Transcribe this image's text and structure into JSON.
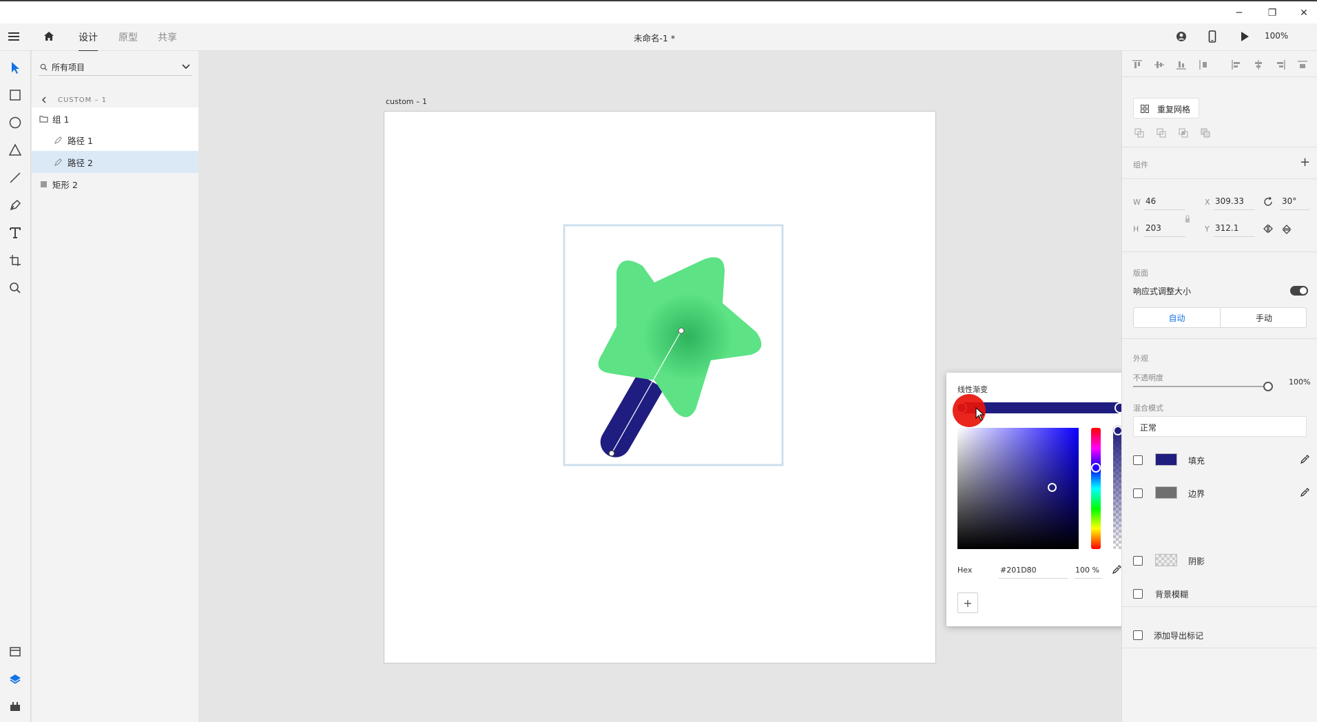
{
  "window": {
    "minimize": "─",
    "restore": "❐",
    "close": "✕"
  },
  "appbar": {
    "tabs": [
      "设计",
      "原型",
      "共享"
    ],
    "doc_title": "未命名-1 *",
    "zoom": "100%"
  },
  "layers": {
    "search_placeholder": "所有项目",
    "breadcrumb": "CUSTOM – 1",
    "items": [
      {
        "label": "组 1"
      },
      {
        "label": "路径 1"
      },
      {
        "label": "路径 2"
      },
      {
        "label": "矩形 2"
      }
    ]
  },
  "canvas": {
    "artboard_label": "custom – 1"
  },
  "props": {
    "repeat_grid": "重复网格",
    "components_label": "组件",
    "w_label": "W",
    "w": "46",
    "h_label": "H",
    "h": "203",
    "x_label": "X",
    "x": "309.33",
    "y_label": "Y",
    "y": "312.1",
    "rotation": "30°",
    "layout_label": "版面",
    "responsive_resize": "响应式调整大小",
    "auto": "自动",
    "manual": "手动",
    "appearance_label": "外观",
    "opacity_label": "不透明度",
    "opacity": "100%",
    "blend_label": "混合模式",
    "blend": "正常",
    "fill": "填充",
    "border": "边界",
    "shadow": "阴影",
    "bg_blur": "背景模糊",
    "export_mark": "添加导出标记",
    "fill_color": "#201D80",
    "border_color": "#707070"
  },
  "picker": {
    "type": "线性渐变",
    "hex_label": "Hex",
    "hex": "#201D80",
    "alpha": "100 %",
    "add": "+"
  },
  "colors": {
    "star": "#5de285",
    "star_center": "#2db45c",
    "stick": "#201D80",
    "accent": "#1473e6",
    "red_cursor": "#e8120b"
  }
}
